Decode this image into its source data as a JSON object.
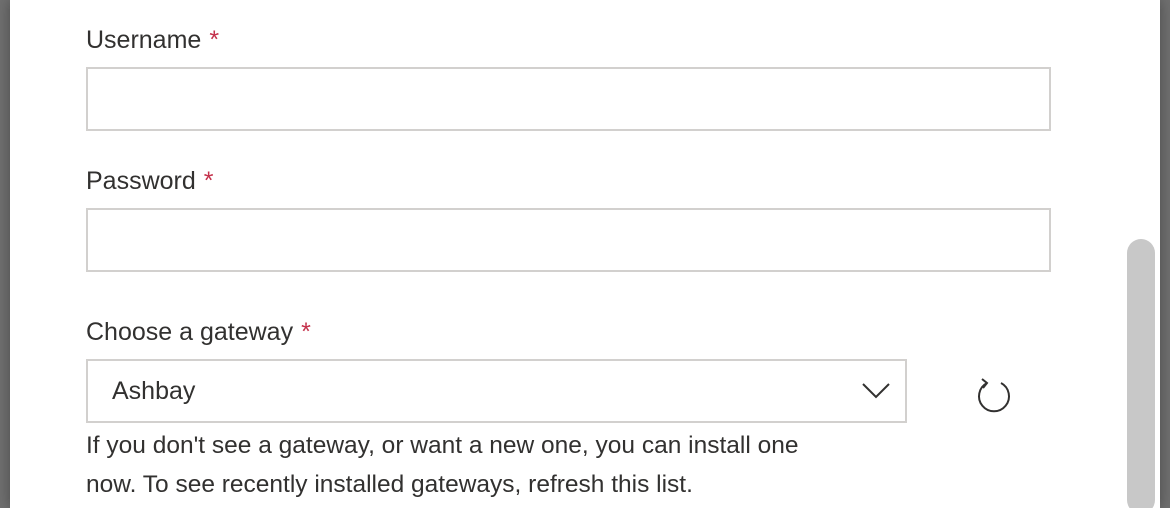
{
  "form": {
    "username": {
      "label": "Username",
      "required_mark": "*",
      "value": ""
    },
    "password": {
      "label": "Password",
      "required_mark": "*",
      "value": ""
    },
    "gateway": {
      "label": "Choose a gateway",
      "required_mark": "*",
      "selected": "Ashbay",
      "help_line1": "If you don't see a gateway, or want a new one, you can install one",
      "help_line2": "now. To see recently installed gateways, refresh this list."
    }
  },
  "icons": {
    "dropdown": "chevron-down-icon",
    "refresh": "refresh-icon"
  },
  "colors": {
    "required": "#c4314b",
    "border": "#d2d0ce",
    "text": "#323130",
    "overlay": "#707070"
  }
}
